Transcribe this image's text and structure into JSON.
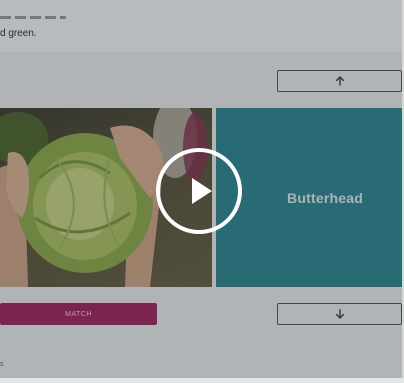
{
  "page": {
    "instruction_text": "d green.",
    "footer_text": "s"
  },
  "card": {
    "label": "Butterhead"
  },
  "buttons": {
    "match_label": "MATCH",
    "up_icon": "arrow-up-icon",
    "down_icon": "arrow-down-icon"
  },
  "video": {
    "play_icon": "play-icon"
  },
  "colors": {
    "card_bg": "#2c8a96",
    "match_bg": "#a7205f",
    "nav_border": "#3f5b63"
  }
}
